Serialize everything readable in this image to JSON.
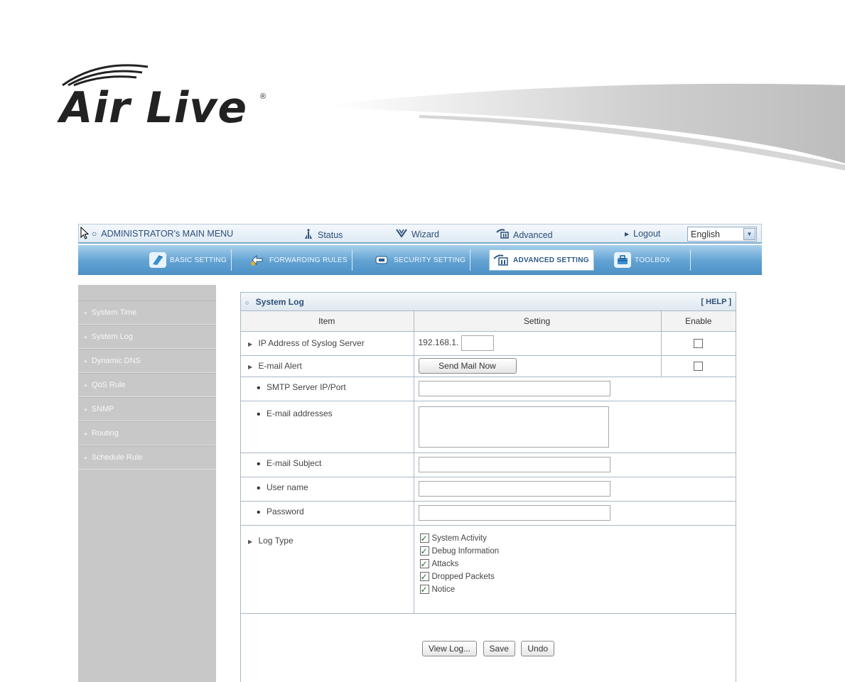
{
  "brand": {
    "name": "Air Live",
    "registered": "®"
  },
  "topbar": {
    "admin_menu": "ADMINISTRATOR's MAIN MENU",
    "status": "Status",
    "wizard": "Wizard",
    "advanced": "Advanced",
    "logout": "Logout",
    "language": "English"
  },
  "tabs": [
    {
      "label": "BASIC SETTING",
      "icon": "basic-setting-icon"
    },
    {
      "label": "FORWARDING RULES",
      "icon": "forwarding-rules-icon"
    },
    {
      "label": "SECURITY SETTING",
      "icon": "security-setting-icon"
    },
    {
      "label": "ADVANCED SETTING",
      "icon": "advanced-setting-icon",
      "active": true
    },
    {
      "label": "TOOLBOX",
      "icon": "toolbox-icon"
    }
  ],
  "sidebar": {
    "items": [
      {
        "label": "System Time"
      },
      {
        "label": "System Log"
      },
      {
        "label": "Dynamic DNS"
      },
      {
        "label": "QoS Rule"
      },
      {
        "label": "SNMP"
      },
      {
        "label": "Routing"
      },
      {
        "label": "Schedule Rule"
      }
    ]
  },
  "panel": {
    "title": "System Log",
    "help": "[ HELP ]",
    "columns": {
      "item": "Item",
      "setting": "Setting",
      "enable": "Enable"
    },
    "rows": {
      "syslog_ip": {
        "label": "IP Address of Syslog Server",
        "prefix": "192.168.1.",
        "value": "",
        "enabled": false
      },
      "email_alert": {
        "label": "E-mail Alert",
        "button": "Send Mail Now",
        "enabled": false
      },
      "smtp": {
        "label": "SMTP Server IP/Port",
        "value": ""
      },
      "addresses": {
        "label": "E-mail addresses",
        "value": ""
      },
      "subject": {
        "label": "E-mail Subject",
        "value": ""
      },
      "username": {
        "label": "User name",
        "value": ""
      },
      "password": {
        "label": "Password",
        "value": ""
      },
      "log_type": {
        "label": "Log Type",
        "options": [
          {
            "label": "System Activity",
            "checked": true
          },
          {
            "label": "Debug Information",
            "checked": true
          },
          {
            "label": "Attacks",
            "checked": true
          },
          {
            "label": "Dropped Packets",
            "checked": true
          },
          {
            "label": "Notice",
            "checked": true
          }
        ]
      }
    },
    "actions": {
      "view_log": "View Log...",
      "save": "Save",
      "undo": "Undo"
    }
  },
  "colors": {
    "nav_blue": "#62a2d2",
    "sidebar_gray": "#c8c8c8",
    "link_blue": "#2c4f77"
  }
}
